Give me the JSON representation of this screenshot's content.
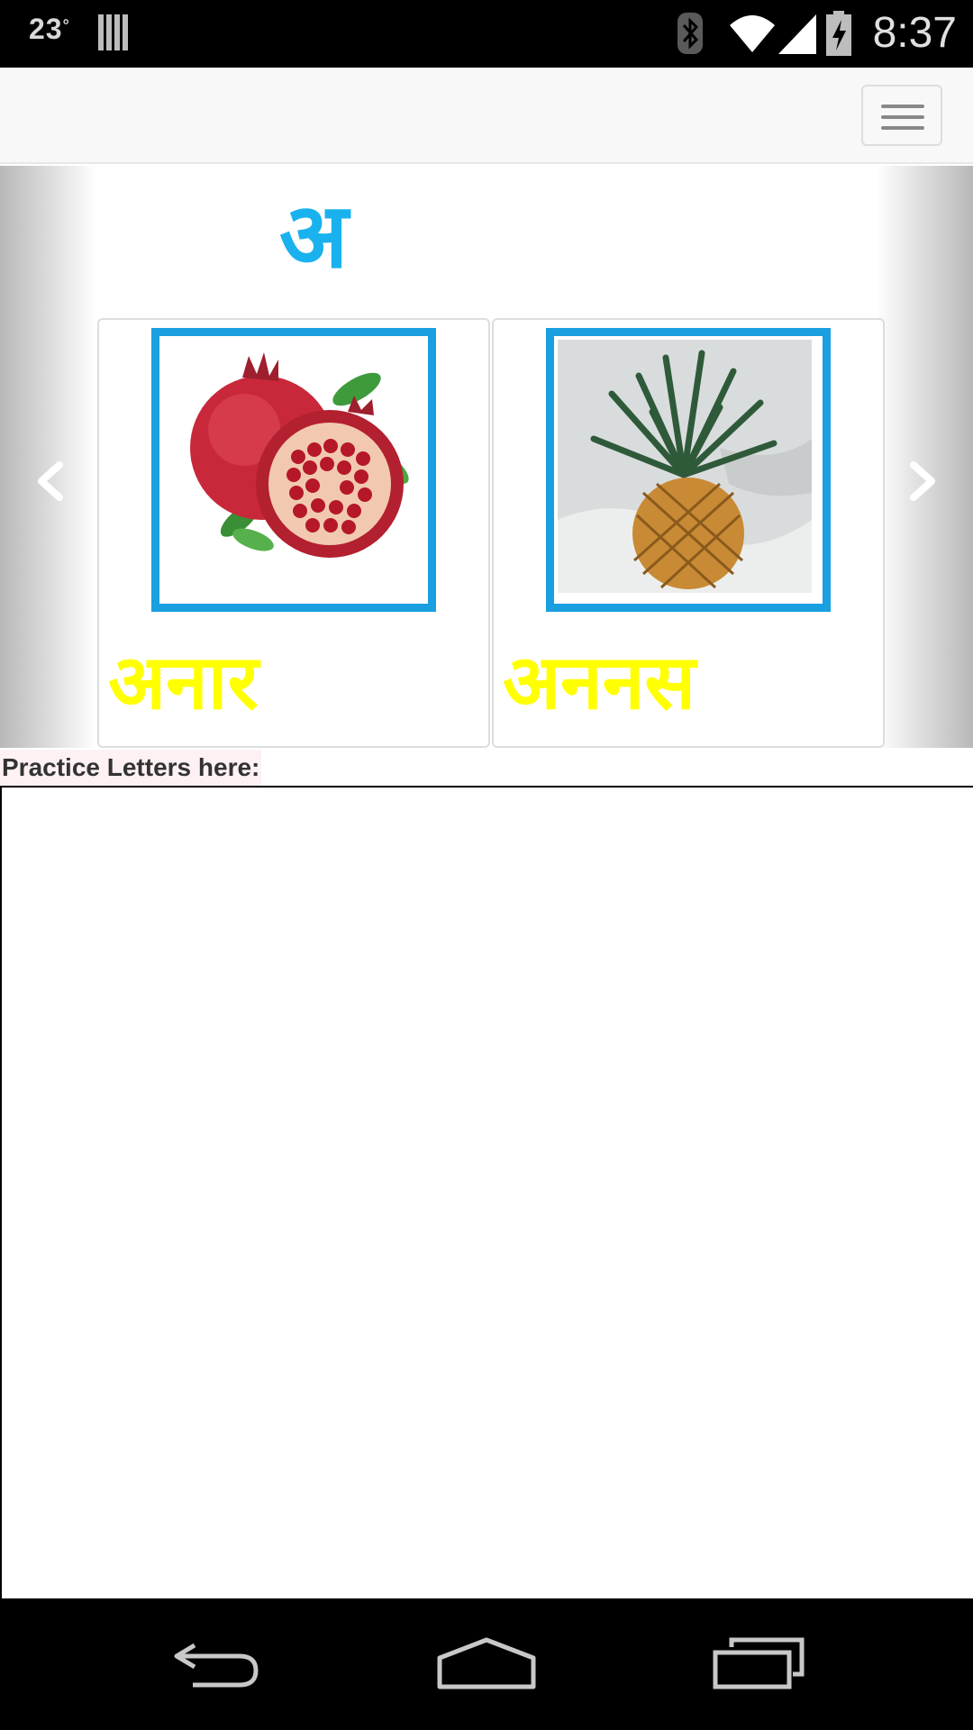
{
  "status_bar": {
    "temperature": "23",
    "degree_symbol": "°",
    "time": "8:37",
    "icons": [
      "notification-icon",
      "bluetooth-icon",
      "wifi-icon",
      "signal-icon",
      "battery-charging-icon"
    ]
  },
  "navbar": {
    "menu_icon": "hamburger-menu-icon"
  },
  "carousel": {
    "letter": "अ",
    "letter_color": "#1ab2ee",
    "word_color": "#ffff00",
    "frame_color": "#1a9fe0",
    "prev_icon": "chevron-left-icon",
    "next_icon": "chevron-right-icon",
    "cards": [
      {
        "word": "अनार",
        "image": "pomegranate-image"
      },
      {
        "word": "अननस",
        "image": "pineapple-image"
      }
    ]
  },
  "practice": {
    "label": "Practice Letters here:"
  },
  "system_nav": {
    "icons": [
      "back-icon",
      "home-icon",
      "recents-icon"
    ]
  }
}
